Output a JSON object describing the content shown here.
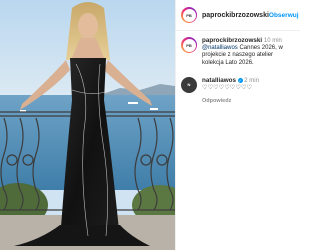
{
  "post": {
    "author": "paprockibrzozowski",
    "follow_label": "Obserwuj",
    "caption": {
      "author": "paprockibrzozowski",
      "time": "10 min",
      "mention": "@natalliawos",
      "text": " Cannes 2026, w projekcie z naszego atelier kolekcja Lato 2026."
    },
    "comments": [
      {
        "author": "natalliawos",
        "time": "2 min",
        "text": "♡♡♡♡♡♡♡♡♡",
        "reply_label": "Odpowiedz"
      }
    ]
  },
  "icons": {
    "verified": "verified-badge-icon"
  },
  "colors": {
    "accent": "#0095f6",
    "mention": "#00376b",
    "muted": "#8e8e8e"
  }
}
